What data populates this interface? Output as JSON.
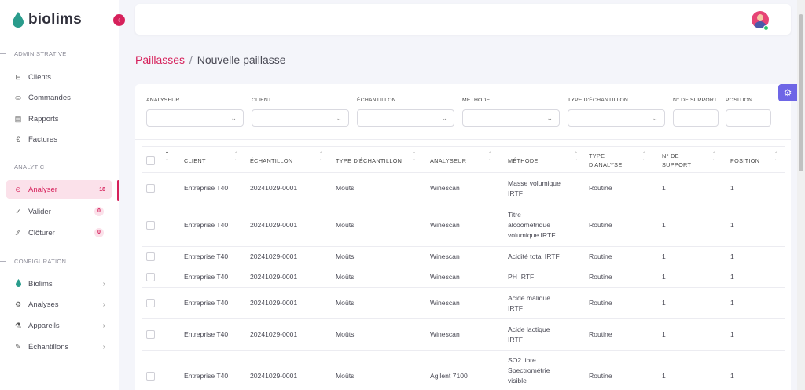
{
  "brand": {
    "name": "biolims",
    "accent": "#d6215b",
    "collapse_icon": "‹"
  },
  "sidebar": {
    "sections": [
      {
        "title": "ADMINISTRATIVE"
      },
      {
        "title": "ANALYTIC"
      },
      {
        "title": "CONFIGURATION"
      }
    ],
    "items": [
      {
        "label": "Clients",
        "icon": "⊟"
      },
      {
        "label": "Commandes",
        "icon": "⛀"
      },
      {
        "label": "Rapports",
        "icon": "▤"
      },
      {
        "label": "Factures",
        "icon": "€"
      },
      {
        "label": "Analyser",
        "icon": "⊙",
        "badge": "18"
      },
      {
        "label": "Valider",
        "icon": "✓",
        "badge": "0"
      },
      {
        "label": "Clôturer",
        "icon": "⁄⁄",
        "badge": "0"
      },
      {
        "label": "Biolims",
        "icon": "●",
        "chevron": "›"
      },
      {
        "label": "Analyses",
        "icon": "⚙",
        "chevron": "›"
      },
      {
        "label": "Appareils",
        "icon": "⚗",
        "chevron": "›"
      },
      {
        "label": "Échantillons",
        "icon": "✎",
        "chevron": "›"
      }
    ]
  },
  "breadcrumb": {
    "root": "Paillasses",
    "separator": "/",
    "current": "Nouvelle paillasse"
  },
  "filters": [
    {
      "label": "ANALYSEUR",
      "value": ""
    },
    {
      "label": "CLIENT",
      "value": ""
    },
    {
      "label": "ÉCHANTILLON",
      "value": ""
    },
    {
      "label": "MÉTHODE",
      "value": ""
    },
    {
      "label": "TYPE D'ÉCHANTILLON",
      "value": ""
    },
    {
      "label": "N° DE SUPPORT",
      "value": ""
    },
    {
      "label": "POSITION",
      "value": ""
    }
  ],
  "table": {
    "columns": [
      "CLIENT",
      "ÉCHANTILLON",
      "TYPE D'ÉCHANTILLON",
      "ANALYSEUR",
      "MÉTHODE",
      "TYPE D'ANALYSE",
      "N° DE SUPPORT",
      "POSITION"
    ],
    "rows": [
      [
        "Entreprise T40",
        "20241029-0001",
        "Moûts",
        "Winescan",
        "Masse volumique IRTF",
        "Routine",
        "1",
        "1"
      ],
      [
        "Entreprise T40",
        "20241029-0001",
        "Moûts",
        "Winescan",
        "Titre alcoométrique volumique IRTF",
        "Routine",
        "1",
        "1"
      ],
      [
        "Entreprise T40",
        "20241029-0001",
        "Moûts",
        "Winescan",
        "Acidité total IRTF",
        "Routine",
        "1",
        "1"
      ],
      [
        "Entreprise T40",
        "20241029-0001",
        "Moûts",
        "Winescan",
        "PH IRTF",
        "Routine",
        "1",
        "1"
      ],
      [
        "Entreprise T40",
        "20241029-0001",
        "Moûts",
        "Winescan",
        "Acide malique IRTF",
        "Routine",
        "1",
        "1"
      ],
      [
        "Entreprise T40",
        "20241029-0001",
        "Moûts",
        "Winescan",
        "Acide lactique IRTF",
        "Routine",
        "1",
        "1"
      ],
      [
        "Entreprise T40",
        "20241029-0001",
        "Moûts",
        "Agilent 7100",
        "SO2 libre Spectrométrie visible",
        "Routine",
        "1",
        "1"
      ]
    ]
  },
  "icons": {
    "settings": "gear-icon",
    "avatar": "user-avatar"
  },
  "colors": {
    "accent": "#d6215b",
    "settings_button": "#6e66e6",
    "online": "#2bc96a"
  }
}
